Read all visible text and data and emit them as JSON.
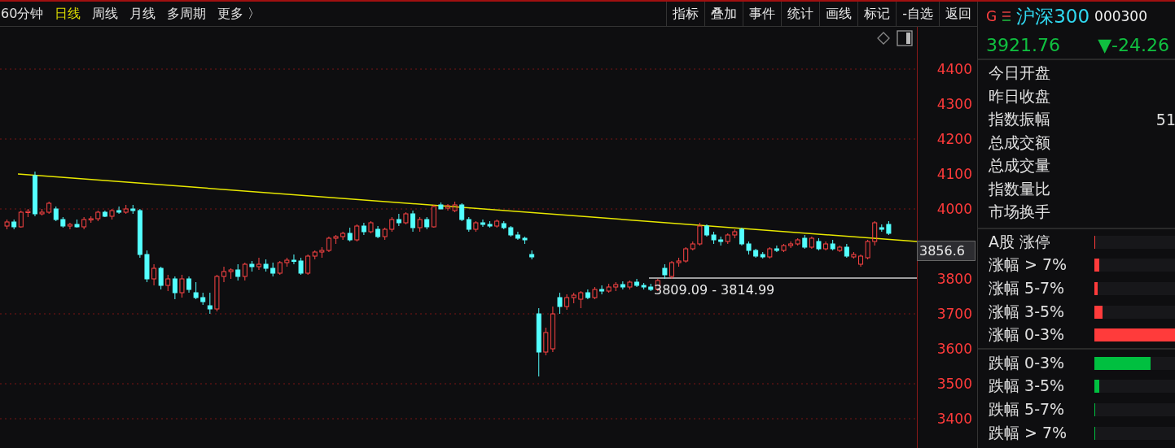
{
  "toolbar": {
    "periods": [
      {
        "label": "60分钟",
        "selected": false
      },
      {
        "label": "日线",
        "selected": true
      },
      {
        "label": "周线",
        "selected": false
      },
      {
        "label": "月线",
        "selected": false
      },
      {
        "label": "多周期",
        "selected": false
      },
      {
        "label": "更多 〉",
        "selected": false
      }
    ],
    "tools": [
      "指标",
      "叠加",
      "事件",
      "统计",
      "画线",
      "标记",
      "-自选",
      "返回"
    ]
  },
  "chart": {
    "range_label": "3809.09 - 3814.99",
    "price_tag": "3856.6",
    "chart_data": {
      "type": "candlestick",
      "grid": true,
      "ylim": [
        3320,
        4520
      ],
      "yticks": [
        4400,
        4300,
        4200,
        4100,
        4000,
        3800,
        3700,
        3600,
        3500,
        3400
      ],
      "categories": [
        null,
        null,
        null,
        null,
        null,
        null,
        null,
        null,
        null,
        null,
        null,
        null,
        null,
        null,
        null,
        null,
        null,
        null,
        null,
        null,
        null,
        null,
        null,
        null,
        null,
        null,
        null,
        null,
        null,
        null,
        null,
        null,
        null,
        null,
        null,
        null,
        null,
        null,
        null,
        null,
        null,
        null,
        null,
        null,
        null,
        null,
        null,
        null,
        null,
        null,
        null,
        null,
        null,
        null,
        null,
        null,
        null,
        null,
        null,
        null,
        null,
        null,
        null,
        null,
        null,
        null,
        null,
        null,
        null,
        null,
        null,
        null,
        null,
        null,
        null,
        null,
        null,
        null,
        null,
        null,
        null,
        null,
        null,
        null,
        null,
        null,
        null,
        null,
        null,
        null,
        null,
        null,
        null,
        null,
        null,
        null,
        null,
        null,
        null,
        null,
        null,
        null,
        null,
        null,
        null,
        null,
        null,
        null,
        null,
        null,
        null,
        null,
        null,
        null,
        null,
        null,
        null,
        null,
        null,
        null,
        null,
        null,
        null,
        null,
        null,
        null,
        null
      ],
      "ohlc": [
        [
          3950,
          3968,
          3942,
          3962
        ],
        [
          3962,
          3970,
          3940,
          3948
        ],
        [
          3948,
          3995,
          3945,
          3990
        ],
        [
          3990,
          4000,
          3975,
          3992
        ],
        [
          4095,
          4105,
          3978,
          3985
        ],
        [
          3985,
          3998,
          3980,
          3990
        ],
        [
          3990,
          4020,
          3985,
          4015
        ],
        [
          4000,
          4005,
          3965,
          3970
        ],
        [
          3968,
          3975,
          3945,
          3950
        ],
        [
          3950,
          3960,
          3940,
          3955
        ],
        [
          3955,
          3970,
          3945,
          3948
        ],
        [
          3948,
          3975,
          3940,
          3970
        ],
        [
          3970,
          3978,
          3960,
          3972
        ],
        [
          3972,
          3995,
          3965,
          3990
        ],
        [
          3990,
          3995,
          3975,
          3978
        ],
        [
          3978,
          4000,
          3970,
          3995
        ],
        [
          3995,
          4005,
          3985,
          3990
        ],
        [
          3990,
          4010,
          3985,
          4000
        ],
        [
          4000,
          4010,
          3985,
          3995
        ],
        [
          3995,
          4000,
          3860,
          3870
        ],
        [
          3870,
          3880,
          3790,
          3800
        ],
        [
          3800,
          3840,
          3780,
          3830
        ],
        [
          3830,
          3835,
          3770,
          3780
        ],
        [
          3780,
          3810,
          3765,
          3800
        ],
        [
          3800,
          3805,
          3740,
          3760
        ],
        [
          3760,
          3810,
          3745,
          3800
        ],
        [
          3800,
          3805,
          3760,
          3770
        ],
        [
          3760,
          3790,
          3740,
          3745
        ],
        [
          3745,
          3760,
          3725,
          3735
        ],
        [
          3722,
          3760,
          3700,
          3712
        ],
        [
          3712,
          3810,
          3705,
          3805
        ],
        [
          3805,
          3835,
          3790,
          3820
        ],
        [
          3820,
          3830,
          3800,
          3825
        ],
        [
          3825,
          3840,
          3795,
          3805
        ],
        [
          3805,
          3845,
          3795,
          3840
        ],
        [
          3840,
          3850,
          3820,
          3835
        ],
        [
          3835,
          3860,
          3825,
          3840
        ],
        [
          3840,
          3855,
          3820,
          3830
        ],
        [
          3830,
          3845,
          3805,
          3815
        ],
        [
          3815,
          3850,
          3810,
          3845
        ],
        [
          3845,
          3860,
          3835,
          3852
        ],
        [
          3852,
          3870,
          3840,
          3850
        ],
        [
          3850,
          3860,
          3810,
          3815
        ],
        [
          3815,
          3870,
          3810,
          3865
        ],
        [
          3865,
          3880,
          3855,
          3875
        ],
        [
          3875,
          3890,
          3860,
          3880
        ],
        [
          3880,
          3920,
          3875,
          3915
        ],
        [
          3915,
          3925,
          3900,
          3920
        ],
        [
          3920,
          3935,
          3910,
          3930
        ],
        [
          3930,
          3945,
          3905,
          3910
        ],
        [
          3910,
          3955,
          3905,
          3950
        ],
        [
          3950,
          3960,
          3925,
          3935
        ],
        [
          3935,
          3965,
          3930,
          3960
        ],
        [
          3940,
          3950,
          3915,
          3920
        ],
        [
          3920,
          3945,
          3910,
          3940
        ],
        [
          3940,
          3975,
          3935,
          3970
        ],
        [
          3970,
          3985,
          3950,
          3960
        ],
        [
          3960,
          3990,
          3955,
          3985
        ],
        [
          3985,
          3995,
          3935,
          3945
        ],
        [
          3945,
          3975,
          3935,
          3970
        ],
        [
          3970,
          3975,
          3940,
          3948
        ],
        [
          3948,
          4010,
          3945,
          4005
        ],
        [
          4010,
          4018,
          3998,
          4000
        ],
        [
          4002,
          4012,
          3995,
          4008
        ],
        [
          3995,
          4020,
          3990,
          4010
        ],
        [
          4010,
          4015,
          3965,
          3970
        ],
        [
          3970,
          3975,
          3935,
          3940
        ],
        [
          3940,
          3965,
          3935,
          3960
        ],
        [
          3960,
          3968,
          3948,
          3955
        ],
        [
          3955,
          3965,
          3945,
          3950
        ],
        [
          3950,
          3970,
          3945,
          3965
        ],
        [
          3958,
          3965,
          3940,
          3945
        ],
        [
          3945,
          3950,
          3920,
          3925
        ],
        [
          3925,
          3935,
          3910,
          3915
        ],
        [
          3915,
          3920,
          3900,
          3910
        ],
        [
          3870,
          3880,
          3855,
          3862
        ],
        [
          3700,
          3715,
          3520,
          3590
        ],
        [
          3590,
          3660,
          3580,
          3645
        ],
        [
          3600,
          3720,
          3590,
          3700
        ],
        [
          3745,
          3760,
          3700,
          3720
        ],
        [
          3720,
          3755,
          3710,
          3745
        ],
        [
          3745,
          3760,
          3730,
          3752
        ],
        [
          3740,
          3765,
          3715,
          3760
        ],
        [
          3760,
          3770,
          3740,
          3745
        ],
        [
          3745,
          3775,
          3740,
          3770
        ],
        [
          3770,
          3780,
          3755,
          3765
        ],
        [
          3765,
          3785,
          3760,
          3775
        ],
        [
          3775,
          3790,
          3765,
          3782
        ],
        [
          3782,
          3792,
          3770,
          3775
        ],
        [
          3775,
          3795,
          3770,
          3790
        ],
        [
          3790,
          3800,
          3775,
          3780
        ],
        [
          3780,
          3788,
          3770,
          3775
        ],
        [
          3775,
          3785,
          3765,
          3770
        ],
        [
          3770,
          3800,
          3765,
          3795
        ],
        [
          3830,
          3840,
          3800,
          3810
        ],
        [
          3805,
          3850,
          3800,
          3845
        ],
        [
          3845,
          3860,
          3835,
          3850
        ],
        [
          3850,
          3890,
          3845,
          3885
        ],
        [
          3885,
          3905,
          3880,
          3900
        ],
        [
          3900,
          3960,
          3895,
          3950
        ],
        [
          3950,
          3955,
          3920,
          3925
        ],
        [
          3925,
          3935,
          3900,
          3910
        ],
        [
          3910,
          3920,
          3895,
          3905
        ],
        [
          3905,
          3930,
          3900,
          3925
        ],
        [
          3925,
          3940,
          3915,
          3935
        ],
        [
          3940,
          3945,
          3895,
          3900
        ],
        [
          3900,
          3905,
          3870,
          3880
        ],
        [
          3880,
          3885,
          3860,
          3865
        ],
        [
          3868,
          3875,
          3858,
          3862
        ],
        [
          3862,
          3890,
          3858,
          3885
        ],
        [
          3885,
          3895,
          3875,
          3880
        ],
        [
          3880,
          3900,
          3875,
          3895
        ],
        [
          3895,
          3905,
          3888,
          3900
        ],
        [
          3900,
          3915,
          3895,
          3910
        ],
        [
          3915,
          3925,
          3885,
          3890
        ],
        [
          3890,
          3920,
          3885,
          3915
        ],
        [
          3905,
          3915,
          3880,
          3885
        ],
        [
          3885,
          3905,
          3880,
          3900
        ],
        [
          3900,
          3910,
          3880,
          3885
        ],
        [
          3880,
          3895,
          3875,
          3890
        ],
        [
          3890,
          3900,
          3860,
          3865
        ],
        [
          3862,
          3875,
          3858,
          3870
        ],
        [
          3840,
          3870,
          3835,
          3865
        ],
        [
          3860,
          3910,
          3855,
          3905
        ],
        [
          3905,
          3965,
          3895,
          3960
        ],
        [
          3945,
          3955,
          3935,
          3940
        ],
        [
          3955,
          3965,
          3925,
          3930
        ]
      ]
    }
  },
  "quote": {
    "badge": "G",
    "name": "沪深300",
    "code": "000300",
    "price": "3921.76",
    "change": "▼-24.26"
  },
  "stats": [
    {
      "label": "今日开盘"
    },
    {
      "label": "昨日收盘"
    },
    {
      "label": "指数振幅",
      "value": "51"
    },
    {
      "label": "总成交额"
    },
    {
      "label": "总成交量"
    },
    {
      "label": "指数量比"
    },
    {
      "label": "市场换手"
    }
  ],
  "breadth_up": [
    {
      "label": "A股 涨停",
      "level": 0.01,
      "color": "#ff3b3b"
    },
    {
      "label": "涨幅 > 7%",
      "level": 0.06,
      "color": "#ff3b3b"
    },
    {
      "label": "涨幅 5-7%",
      "level": 0.04,
      "color": "#ff3b3b"
    },
    {
      "label": "涨幅 3-5%",
      "level": 0.1,
      "color": "#ff3b3b"
    },
    {
      "label": "涨幅 0-3%",
      "level": 1,
      "color": "#ff3b3b"
    }
  ],
  "breadth_down": [
    {
      "label": "跌幅 0-3%",
      "level": 0.69,
      "color": "#00c040"
    },
    {
      "label": "跌幅 3-5%",
      "level": 0.06,
      "color": "#00c040"
    },
    {
      "label": "跌幅 5-7%",
      "level": 0.01,
      "color": "#00c040"
    },
    {
      "label": "跌幅 > 7%",
      "level": 0.01,
      "color": "#00c040"
    }
  ]
}
